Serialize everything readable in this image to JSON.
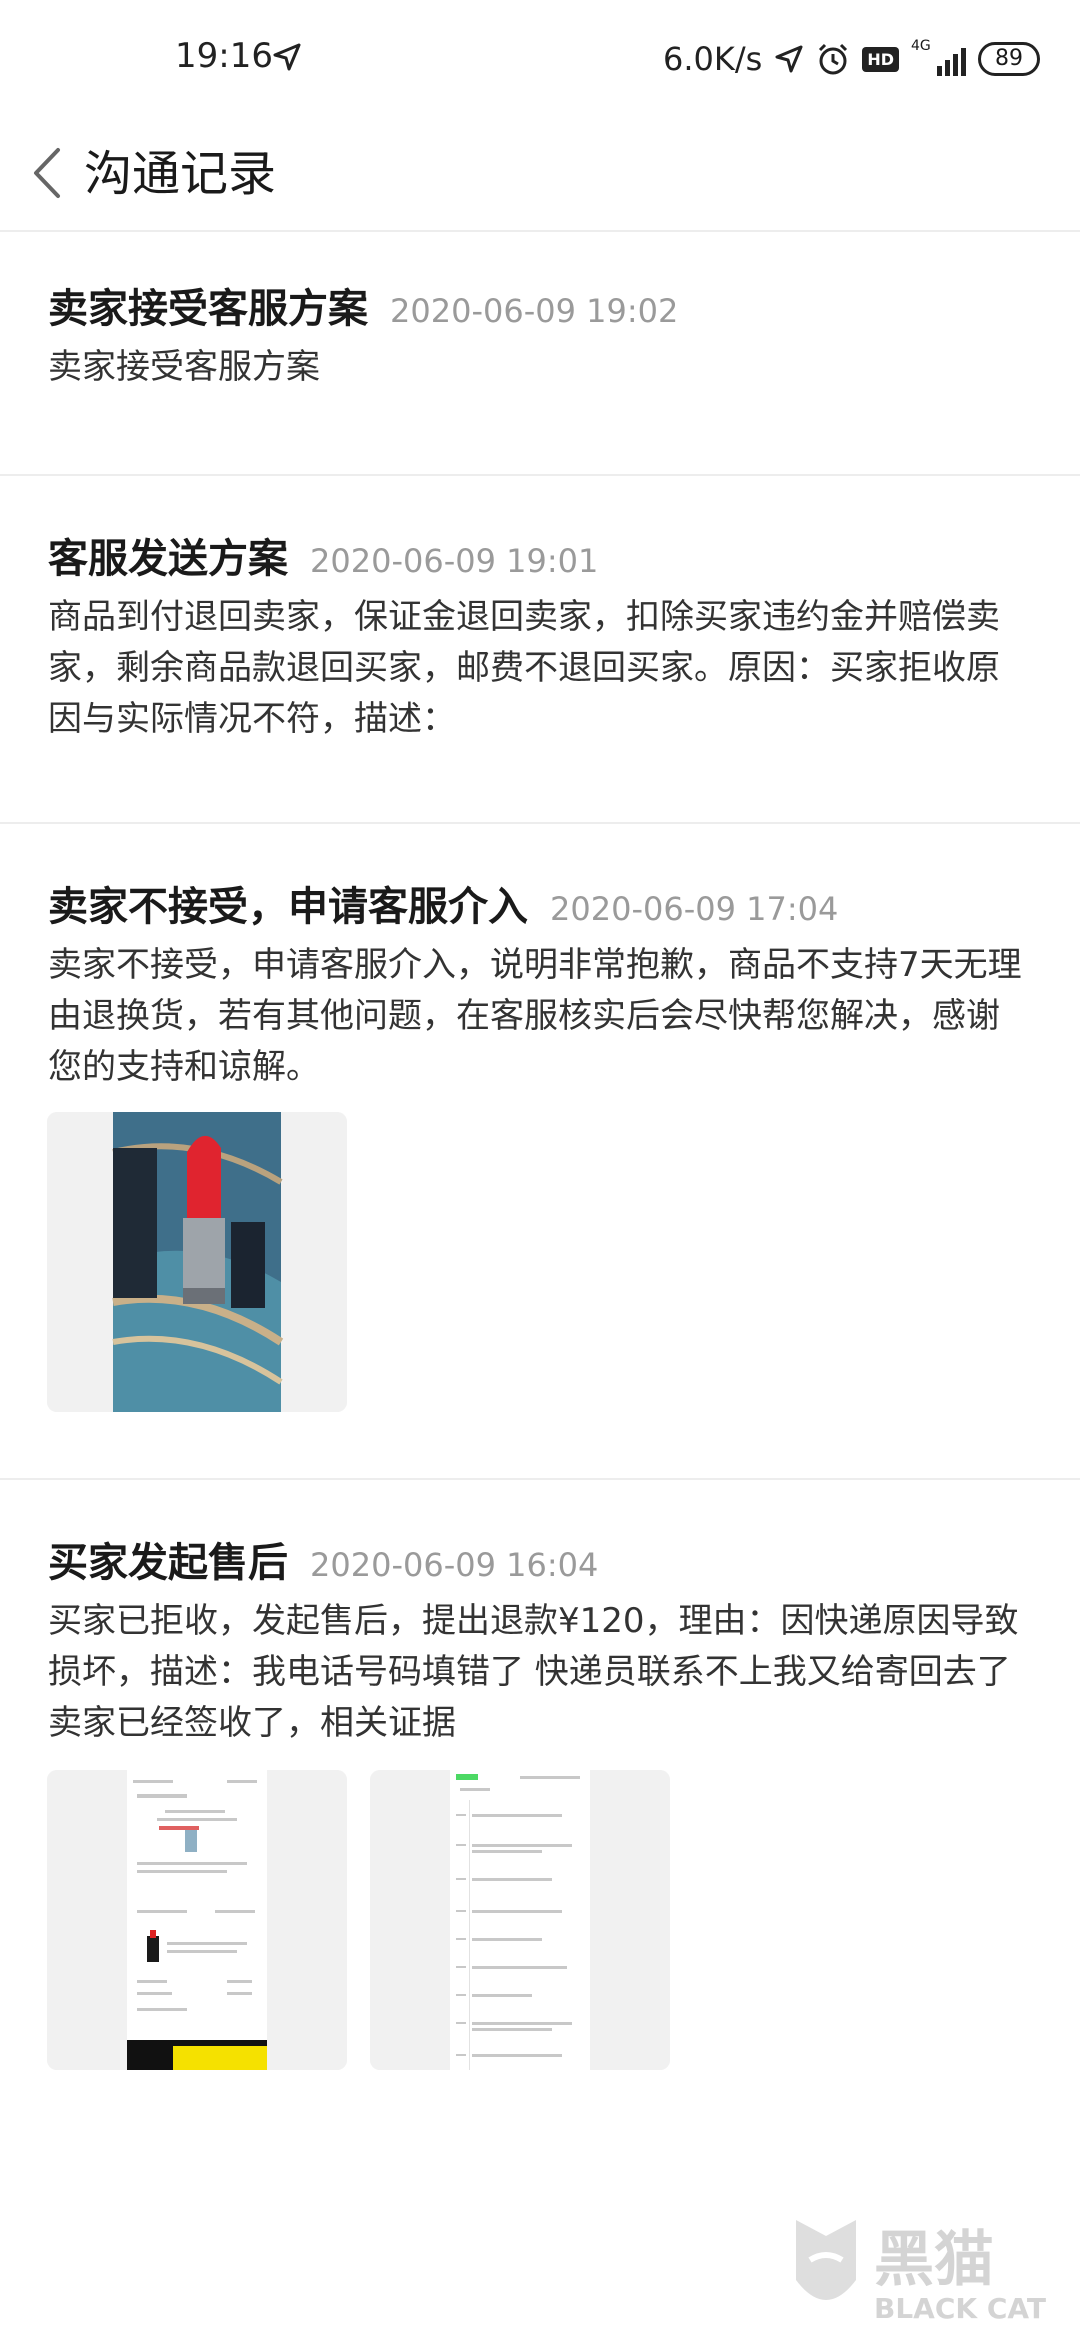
{
  "status_bar": {
    "time": "19:16",
    "speed": "6.0K/s",
    "hd": "HD",
    "network": "4G",
    "battery": "89"
  },
  "header": {
    "title": "沟通记录"
  },
  "records": [
    {
      "title": "卖家接受客服方案",
      "time": "2020-06-09 19:02",
      "body": "卖家接受客服方案"
    },
    {
      "title": "客服发送方案",
      "time": "2020-06-09 19:01",
      "body": "商品到付退回卖家，保证金退回卖家，扣除买家违约金并赔偿卖家，剩余商品款退回买家，邮费不退回买家。原因：买家拒收原因与实际情况不符，描述："
    },
    {
      "title": "卖家不接受，申请客服介入",
      "time": "2020-06-09 17:04",
      "body": "卖家不接受，申请客服介入，说明非常抱歉，商品不支持7天无理由退换货，若有其他问题，在客服核实后会尽快帮您解决，感谢您的支持和谅解。"
    },
    {
      "title": "买家发起售后",
      "time": "2020-06-09 16:04",
      "body": "买家已拒收，发起售后，提出退款¥120，理由：因快递原因导致损坏，描述：我电话号码填错了 快递员联系不上我又给寄回去了 卖家已经签收了，相关证据"
    }
  ],
  "watermark": {
    "cn": "黑猫",
    "en": "BLACK CAT"
  },
  "colors": {
    "divider": "#ededed",
    "timestamp": "#9a9a9a",
    "yellow": "#f5e100",
    "green": "#4cd964"
  }
}
